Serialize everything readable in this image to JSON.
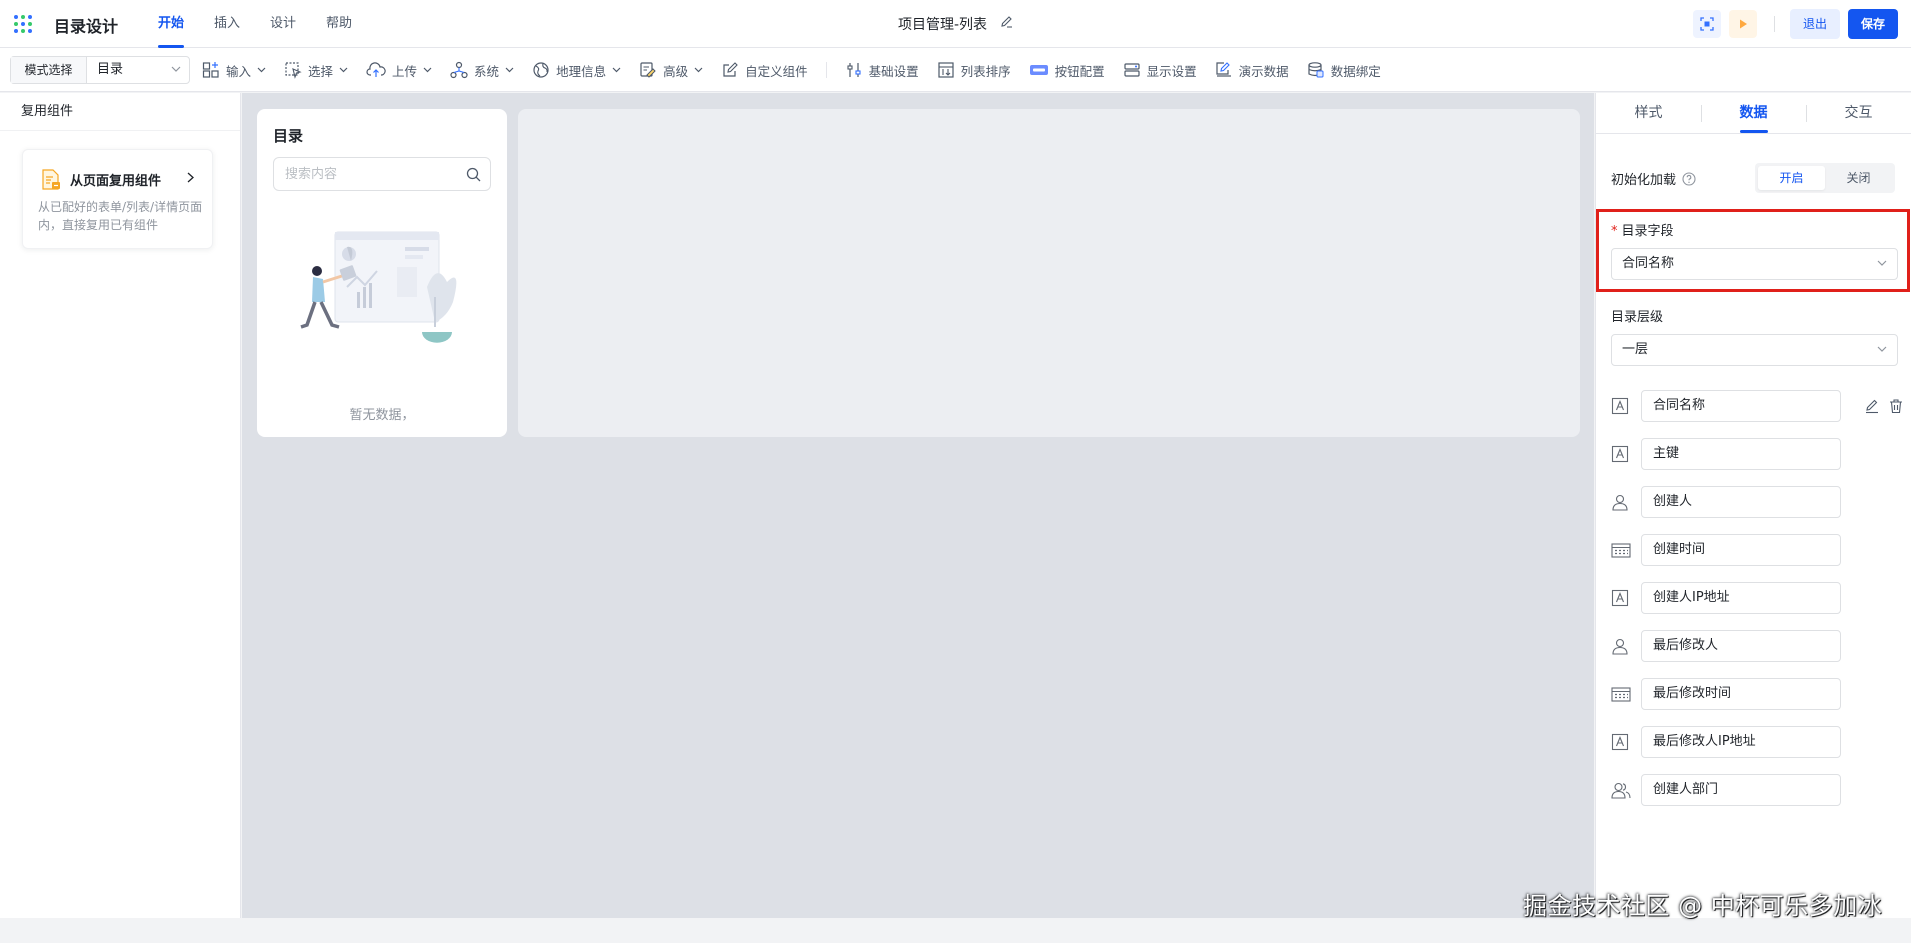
{
  "header": {
    "app_title": "目录设计",
    "tabs": [
      {
        "label": "开始",
        "active": true
      },
      {
        "label": "插入",
        "active": false
      },
      {
        "label": "设计",
        "active": false
      },
      {
        "label": "帮助",
        "active": false
      }
    ],
    "doc_title": "项目管理-列表",
    "exit_label": "退出",
    "save_label": "保存"
  },
  "toolbar": {
    "mode_label": "模式选择",
    "mode_value": "目录",
    "items": [
      {
        "label": "输入",
        "icon": "input-icon",
        "dropdown": true
      },
      {
        "label": "选择",
        "icon": "select-icon",
        "dropdown": true
      },
      {
        "label": "上传",
        "icon": "upload-cloud-icon",
        "dropdown": true
      },
      {
        "label": "系统",
        "icon": "system-icon",
        "dropdown": true
      },
      {
        "label": "地理信息",
        "icon": "globe-icon",
        "dropdown": true
      },
      {
        "label": "高级",
        "icon": "advanced-icon",
        "dropdown": true
      },
      {
        "label": "自定义组件",
        "icon": "custom-edit-icon",
        "dropdown": false
      },
      {
        "label": "基础设置",
        "icon": "settings-icon",
        "dropdown": false
      },
      {
        "label": "列表排序",
        "icon": "sort-icon",
        "dropdown": false
      },
      {
        "label": "按钮配置",
        "icon": "button-config-icon",
        "dropdown": false
      },
      {
        "label": "显示设置",
        "icon": "display-icon",
        "dropdown": false
      },
      {
        "label": "演示数据",
        "icon": "demo-data-icon",
        "dropdown": false
      },
      {
        "label": "数据绑定",
        "icon": "database-icon",
        "dropdown": false
      }
    ]
  },
  "left_panel": {
    "header": "复用组件",
    "card_title": "从页面复用组件",
    "card_desc": "从已配好的表单/列表/详情页面内，直接复用已有组件"
  },
  "canvas": {
    "dir_title": "目录",
    "search_placeholder": "搜索内容",
    "empty_text": "暂无数据，"
  },
  "right_panel": {
    "tabs": [
      {
        "label": "样式",
        "active": false
      },
      {
        "label": "数据",
        "active": true
      },
      {
        "label": "交互",
        "active": false
      }
    ],
    "init_label": "初始化加载",
    "switch_on": "开启",
    "switch_off": "关闭",
    "dir_field_label": "目录字段",
    "dir_field_value": "合同名称",
    "level_label": "目录层级",
    "level_value": "一层",
    "fields": [
      {
        "label": "合同名称",
        "icon": "text-field-icon"
      },
      {
        "label": "主键",
        "icon": "text-field-icon"
      },
      {
        "label": "创建人",
        "icon": "user-icon"
      },
      {
        "label": "创建时间",
        "icon": "calendar-icon"
      },
      {
        "label": "创建人IP地址",
        "icon": "text-field-icon"
      },
      {
        "label": "最后修改人",
        "icon": "user-icon"
      },
      {
        "label": "最后修改时间",
        "icon": "calendar-icon"
      },
      {
        "label": "最后修改人IP地址",
        "icon": "text-field-icon"
      },
      {
        "label": "创建人部门",
        "icon": "department-icon"
      }
    ]
  },
  "watermark": "掘金技术社区 @ 中杯可乐多加冰",
  "colors": {
    "accent": "#1456f0",
    "highlight": "#e0201a",
    "canvas_bg": "#dde0e6"
  }
}
